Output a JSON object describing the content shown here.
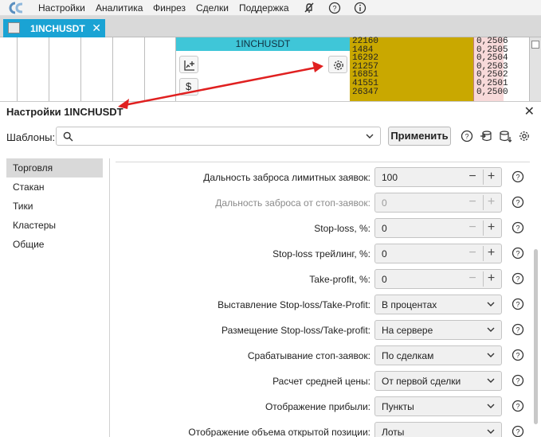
{
  "menu": {
    "items": [
      "Настройки",
      "Аналитика",
      "Финрез",
      "Сделки",
      "Поддержка"
    ]
  },
  "tab": {
    "title": "1INCHUSDT",
    "close": "✕"
  },
  "chart": {
    "symbol": "1INCHUSDT"
  },
  "orderbook": {
    "volumes": [
      "22160",
      "1484",
      "16292",
      "21257",
      "16851",
      "41551",
      "26347"
    ],
    "prices": [
      "0,2506",
      "0,2505",
      "0,2504",
      "0,2503",
      "0,2502",
      "0,2501",
      "0,2500"
    ]
  },
  "dialog": {
    "title": "Настройки 1INCHUSDT",
    "close": "✕",
    "templates_label": "Шаблоны:",
    "apply_label": "Применить",
    "sidebar": [
      "Торговля",
      "Стакан",
      "Тики",
      "Кластеры",
      "Общие"
    ],
    "active_section": "Торговля",
    "rows": [
      {
        "label": "Дальность заброса лимитных заявок:",
        "kind": "number",
        "value": "100",
        "disabled": false
      },
      {
        "label": "Дальность заброса от стоп-заявок:",
        "kind": "number",
        "value": "0",
        "disabled": true
      },
      {
        "label": "Stop-loss, %:",
        "kind": "number",
        "value": "0",
        "disabled": false
      },
      {
        "label": "Stop-loss трейлинг, %:",
        "kind": "number",
        "value": "0",
        "disabled": false
      },
      {
        "label": "Take-profit, %:",
        "kind": "number",
        "value": "0",
        "disabled": false
      },
      {
        "label": "Выставление Stop-loss/Take-Profit:",
        "kind": "select",
        "value": "В процентах"
      },
      {
        "label": "Размещение Stop-loss/Take-profit:",
        "kind": "select",
        "value": "На сервере"
      },
      {
        "label": "Срабатывание стоп-заявок:",
        "kind": "select",
        "value": "По сделкам"
      },
      {
        "label": "Расчет средней цены:",
        "kind": "select",
        "value": "От первой сделки"
      },
      {
        "label": "Отображение прибыли:",
        "kind": "select",
        "value": "Пункты"
      },
      {
        "label": "Отображение объема открытой позиции:",
        "kind": "select",
        "value": "Лоты"
      }
    ]
  },
  "colors": {
    "accent": "#1aa3d4",
    "chart_header": "#3fc6d8",
    "orderbook_volume": "#c9a800",
    "orderbook_price": "#f7d9d9",
    "arrow": "#e02020"
  }
}
